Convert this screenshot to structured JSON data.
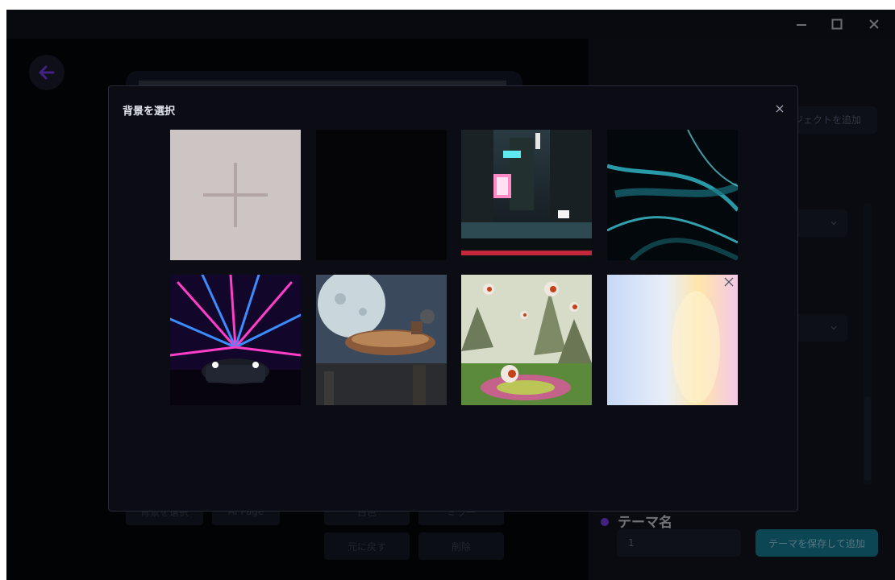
{
  "window": {
    "controls": [
      "minimize",
      "maximize",
      "close"
    ]
  },
  "left_toolbar": {
    "select_background_label": "背景を選択",
    "ai_page_label": "AI Page",
    "button_3_label": "白色",
    "button_4_label": "ミラー",
    "undo_label": "元に戻す",
    "delete_label": "削除"
  },
  "right_panel": {
    "add_object_label": "ジェクトを追加",
    "theme_name_label": "テーマ名",
    "theme_name_value": "1",
    "save_add_label": "テーマを保存して追加"
  },
  "modal": {
    "title": "背景を選択",
    "tiles": [
      {
        "name": "add-background",
        "icon": "plus-icon"
      },
      {
        "name": "black"
      },
      {
        "name": "cyberpunk-street"
      },
      {
        "name": "teal-abstract-streaks"
      },
      {
        "name": "neon-tunnel-car"
      },
      {
        "name": "moon-airship"
      },
      {
        "name": "eyeball-landscape"
      },
      {
        "name": "pastel-gradient",
        "removable": true
      }
    ]
  },
  "colors": {
    "accent_purple": "#7a3ef0",
    "save_button": "#17829e",
    "modal_bg": "#0c0d14"
  }
}
